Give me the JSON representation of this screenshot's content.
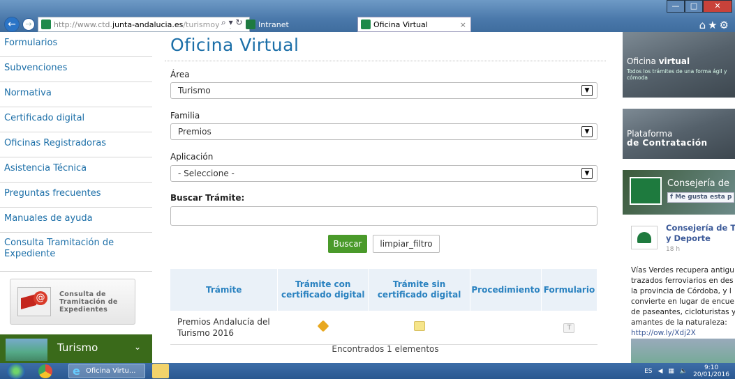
{
  "browser": {
    "url_prefix": "http://www.ctd.",
    "url_domain": "junta-andalucia.es",
    "url_suffix": "/turismoydep",
    "tab_intranet": "Intranet",
    "tab_active": "Oficina Virtual",
    "tab_close": "×"
  },
  "sidebar": {
    "items": [
      {
        "label": "Formularios"
      },
      {
        "label": "Subvenciones"
      },
      {
        "label": "Normativa"
      },
      {
        "label": "Certificado digital"
      },
      {
        "label": "Oficinas Registradoras"
      },
      {
        "label": "Asistencia Técnica"
      },
      {
        "label": "Preguntas frecuentes"
      },
      {
        "label": "Manuales de ayuda"
      },
      {
        "label": "Consulta Tramitación de Expediente"
      }
    ],
    "consulta_box": {
      "line1": "Consulta de",
      "line2": "Tramitación de",
      "line3": "Expedientes"
    },
    "turismo_label": "Turismo"
  },
  "main": {
    "title": "Oficina Virtual",
    "area_label": "Área",
    "area_value": "Turismo",
    "familia_label": "Familia",
    "familia_value": "Premios",
    "aplicacion_label": "Aplicación",
    "aplicacion_value": "- Seleccione -",
    "buscar_label": "Buscar Trámite:",
    "buscar_value": "",
    "buscar_button": "Buscar",
    "limpiar_button": "limpiar_filtro",
    "table": {
      "headers": [
        "Trámite",
        "Trámite con certificado digital",
        "Trámite sin certificado digital",
        "Procedimiento",
        "Formulario"
      ],
      "rows": [
        {
          "tramite": "Premios Andalucía del Turismo 2016"
        }
      ]
    },
    "found_text": "Encontrados 1 elementos"
  },
  "right": {
    "banner1_title_a": "Oficina ",
    "banner1_title_b": "virtual",
    "banner1_sub": "Todos los trámites de una forma ágil y cómoda",
    "banner2_line1": "Plataforma",
    "banner2_line2": "de Contratación",
    "fb_name": "Consejería de",
    "fb_like": "Me gusta esta p",
    "post_author_1": "Consejería de Tu",
    "post_author_2": "y Deporte",
    "post_time": "18 h",
    "post_lines": [
      "Vías Verdes recupera antigu",
      "trazados ferroviarios en des",
      "la provincia de Córdoba, y l",
      "convierte en lugar de encue",
      "de paseantes, cicloturistas y",
      "amantes de la naturaleza:"
    ],
    "post_link": "http://ow.ly/Xdj2X"
  },
  "taskbar": {
    "ie_label": "Oficina Virtu...",
    "lang": "ES",
    "time": "9:10",
    "date": "20/01/2016"
  }
}
